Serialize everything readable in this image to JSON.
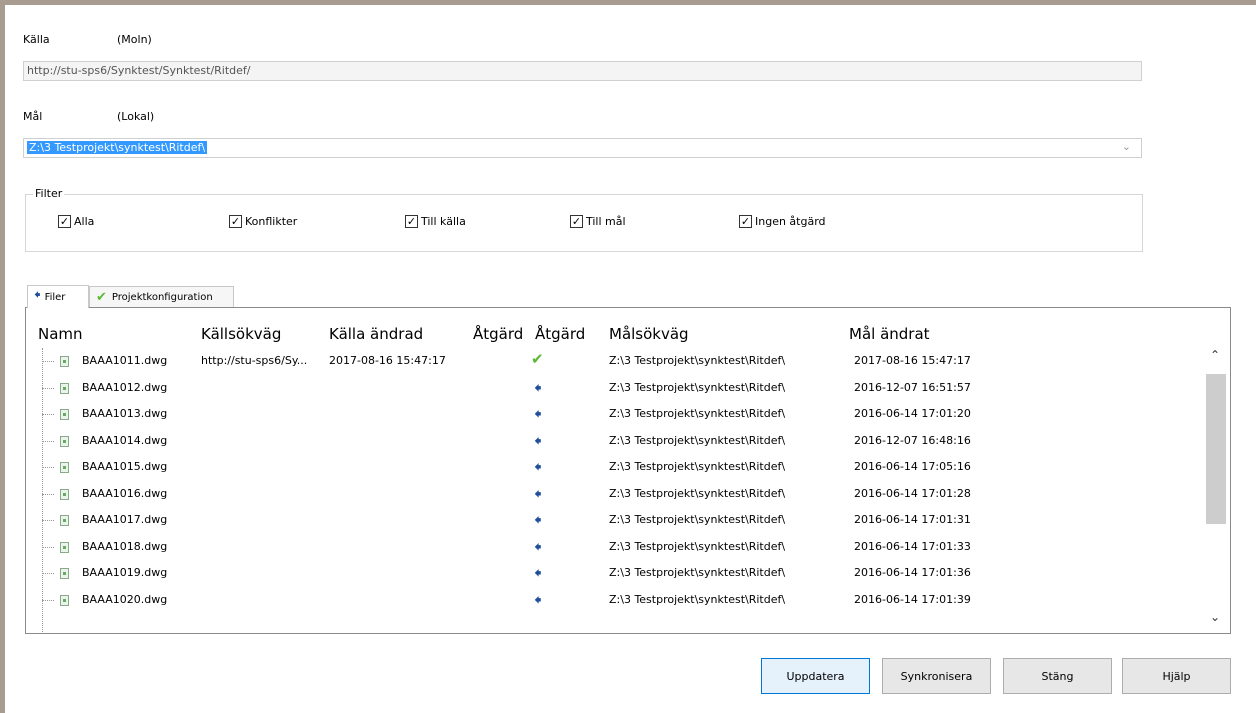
{
  "source": {
    "label": "Källa",
    "type": "(Moln)",
    "path": "http://stu-sps6/Synktest/Synktest/Ritdef/"
  },
  "target": {
    "label": "Mål",
    "type": "(Lokal)",
    "path": "Z:\\3 Testprojekt\\synktest\\Ritdef\\"
  },
  "filter": {
    "title": "Filter",
    "options": [
      {
        "label": "Alla",
        "checked": true
      },
      {
        "label": "Konflikter",
        "checked": true
      },
      {
        "label": "Till källa",
        "checked": true
      },
      {
        "label": "Till mål",
        "checked": true
      },
      {
        "label": "Ingen åtgärd",
        "checked": true
      }
    ]
  },
  "tabs": [
    {
      "label": "Filer",
      "icon": "arrow-left-icon"
    },
    {
      "label": "Projektkonfiguration",
      "icon": "checkmark-icon"
    }
  ],
  "columns": [
    "Namn",
    "Källsökväg",
    "Källa ändrad",
    "Åtgärd",
    "Åtgärd",
    "Målsökväg",
    "Mål ändrat"
  ],
  "rows": [
    {
      "name": "BAAA1011.dwg",
      "src": "http://stu-sps6/Sy...",
      "src_changed": "2017-08-16 15:47:17",
      "action": "check",
      "target": "Z:\\3 Testprojekt\\synktest\\Ritdef\\",
      "target_changed": "2017-08-16 15:47:17"
    },
    {
      "name": "BAAA1012.dwg",
      "src": "",
      "src_changed": "",
      "action": "arrow",
      "target": "Z:\\3 Testprojekt\\synktest\\Ritdef\\",
      "target_changed": "2016-12-07 16:51:57"
    },
    {
      "name": "BAAA1013.dwg",
      "src": "",
      "src_changed": "",
      "action": "arrow",
      "target": "Z:\\3 Testprojekt\\synktest\\Ritdef\\",
      "target_changed": "2016-06-14 17:01:20"
    },
    {
      "name": "BAAA1014.dwg",
      "src": "",
      "src_changed": "",
      "action": "arrow",
      "target": "Z:\\3 Testprojekt\\synktest\\Ritdef\\",
      "target_changed": "2016-12-07 16:48:16"
    },
    {
      "name": "BAAA1015.dwg",
      "src": "",
      "src_changed": "",
      "action": "arrow",
      "target": "Z:\\3 Testprojekt\\synktest\\Ritdef\\",
      "target_changed": "2016-06-14 17:05:16"
    },
    {
      "name": "BAAA1016.dwg",
      "src": "",
      "src_changed": "",
      "action": "arrow",
      "target": "Z:\\3 Testprojekt\\synktest\\Ritdef\\",
      "target_changed": "2016-06-14 17:01:28"
    },
    {
      "name": "BAAA1017.dwg",
      "src": "",
      "src_changed": "",
      "action": "arrow",
      "target": "Z:\\3 Testprojekt\\synktest\\Ritdef\\",
      "target_changed": "2016-06-14 17:01:31"
    },
    {
      "name": "BAAA1018.dwg",
      "src": "",
      "src_changed": "",
      "action": "arrow",
      "target": "Z:\\3 Testprojekt\\synktest\\Ritdef\\",
      "target_changed": "2016-06-14 17:01:33"
    },
    {
      "name": "BAAA1019.dwg",
      "src": "",
      "src_changed": "",
      "action": "arrow",
      "target": "Z:\\3 Testprojekt\\synktest\\Ritdef\\",
      "target_changed": "2016-06-14 17:01:36"
    },
    {
      "name": "BAAA1020.dwg",
      "src": "",
      "src_changed": "",
      "action": "arrow",
      "target": "Z:\\3 Testprojekt\\synktest\\Ritdef\\",
      "target_changed": "2016-06-14 17:01:39"
    }
  ],
  "buttons": {
    "update": "Uppdatera",
    "sync": "Synkronisera",
    "close": "Stäng",
    "help": "Hjälp"
  },
  "colors": {
    "selection": "#3399ff",
    "arrow": "#1f4e9a",
    "check": "#5cb82e",
    "primary_border": "#0078d7"
  }
}
